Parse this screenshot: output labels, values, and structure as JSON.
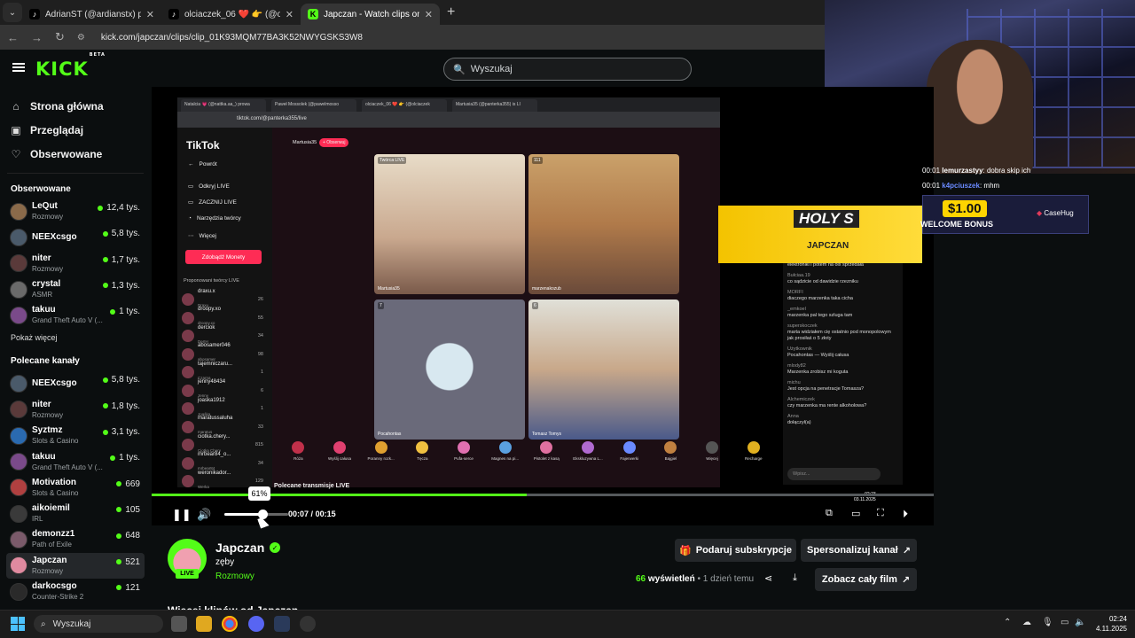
{
  "browser": {
    "tabs": [
      {
        "title": "AdrianST (@ardianstx) prowadzi",
        "active": false,
        "favicon": "tiktok-icon"
      },
      {
        "title": "olciaczek_06 ❤️ 👉 (@olciaczek",
        "active": false,
        "favicon": "tiktok-icon"
      },
      {
        "title": "Japczan - Watch clips on Kick",
        "active": true,
        "favicon": "kick-icon"
      }
    ],
    "url": "kick.com/japczan/clips/clip_01K93MQM77BA3K52NWYGSKS3W8"
  },
  "site": {
    "logo": "KICK",
    "logo_sup": "BETA",
    "search_placeholder": "Wyszukaj"
  },
  "sidebar": {
    "nav": [
      {
        "label": "Strona główna",
        "icon": "home-icon"
      },
      {
        "label": "Przeglądaj",
        "icon": "browse-icon"
      },
      {
        "label": "Obserwowane",
        "icon": "heart-icon"
      }
    ],
    "followed_title": "Obserwowane",
    "followed": [
      {
        "name": "LeQut",
        "category": "Rozmowy",
        "viewers": "12,4 tys.",
        "color": "#8a6a4a"
      },
      {
        "name": "NEEXcsgo",
        "category": "",
        "viewers": "5,8 tys.",
        "color": "#4a5a6a"
      },
      {
        "name": "niter",
        "category": "Rozmowy",
        "viewers": "1,7 tys.",
        "color": "#5a3a3a"
      },
      {
        "name": "crystal",
        "category": "ASMR",
        "viewers": "1,3 tys.",
        "color": "#6a6a6a"
      },
      {
        "name": "takuu",
        "category": "Grand Theft Auto V (...",
        "viewers": "1 tys.",
        "color": "#7a4a8a"
      }
    ],
    "show_more": "Pokaż więcej",
    "recommended_title": "Polecane kanały",
    "recommended": [
      {
        "name": "NEEXcsgo",
        "category": "",
        "viewers": "5,8 tys.",
        "color": "#4a5a6a"
      },
      {
        "name": "niter",
        "category": "Rozmowy",
        "viewers": "1,8 tys.",
        "color": "#5a3a3a"
      },
      {
        "name": "Syztmz",
        "category": "Slots & Casino",
        "viewers": "3,1 tys.",
        "color": "#2a6ab0"
      },
      {
        "name": "takuu",
        "category": "Grand Theft Auto V (...",
        "viewers": "1 tys.",
        "color": "#7a4a8a"
      },
      {
        "name": "Motivation",
        "category": "Slots & Casino",
        "viewers": "669",
        "color": "#b04040"
      },
      {
        "name": "aikoiemil",
        "category": "IRL",
        "viewers": "105",
        "color": "#3a3a3a"
      },
      {
        "name": "demonzz1",
        "category": "Path of Exile",
        "viewers": "648",
        "color": "#7a5a6a"
      },
      {
        "name": "Japczan",
        "category": "Rozmowy",
        "viewers": "521",
        "color": "#e08aa0",
        "selected": true
      },
      {
        "name": "darkocsgo",
        "category": "Counter-Strike 2",
        "viewers": "121",
        "color": "#2a2a2a"
      }
    ]
  },
  "video": {
    "inner_tabs": [
      "Natalcia 💗 (@nattka.aa_) prowa",
      "Paweł Mossolek (@pawelmosso",
      "olciaczek_06 ❤️ 👉 (@olciaczek",
      "Martusia35 (@panterka355) is LI"
    ],
    "inner_url": "tiktok.com/@panterka355/live",
    "tiktok": {
      "logo": "TikTok",
      "menu": [
        "Powrót",
        "Odkryj LIVE",
        "ZACZNIJ LIVE",
        "Narzędzia twórcy",
        "Więcej"
      ],
      "coins_button": "Zdobądź Monety",
      "suggested_title": "Proponowani twórcy LIVE",
      "creators": [
        {
          "name": "draxu.x",
          "sub": "Draxu",
          "count": "26"
        },
        {
          "name": "droopy.xo",
          "sub": "droopy.xo",
          "count": "55"
        },
        {
          "name": "derciok",
          "sub": "DerIH",
          "count": "34"
        },
        {
          "name": "abosamer046",
          "sub": "abosamer",
          "count": "98"
        },
        {
          "name": "tajemniczaru...",
          "sub": "Czarna",
          "count": "1"
        },
        {
          "name": "jenny48434",
          "sub": "Jenny",
          "count": "6"
        },
        {
          "name": "joaska1912",
          "sub": "Joaśka",
          "count": "1"
        },
        {
          "name": "maratussaluha",
          "sub": "maratus",
          "count": "33"
        },
        {
          "name": "ciotka.chery...",
          "sub": "Ciotka Chery",
          "count": "815"
        },
        {
          "name": "mrbear84_o...",
          "sub": "mrbear84",
          "count": "34"
        },
        {
          "name": "weronikador...",
          "sub": "Werka",
          "count": "129"
        }
      ],
      "host": "Martusia35",
      "follow_btn": "+ Obserwuj",
      "tiles": [
        {
          "label": "Martusia35",
          "tag": "Twórca LIVE"
        },
        {
          "label": "marzenakozub",
          "tag": "111"
        },
        {
          "label": "Pocahontas",
          "tag": "7"
        },
        {
          "label": "Tomasz Tomys",
          "tag": "6"
        }
      ],
      "gifts": [
        "Róża",
        "Wyślij całusa",
        "Poranny rozk...",
        "Tęcza",
        "Pufa-serce",
        "Magnes na pi...",
        "Pistolet z kasą",
        "Ekskluzywna L...",
        "Fajerwerki",
        "Bajgiel",
        "Więcej",
        "Recharge"
      ],
      "recommended_live": "Polecane transmisje LIVE",
      "chat": [
        {
          "user": "",
          "text": "ta klawiaturę dostała jak rozdawali w muzeum elektroniki i potem na olx sprzedała"
        },
        {
          "user": "Bułciaa.19",
          "text": "co sądzicie od dawidzie rzezniku"
        },
        {
          "user": "MORFI",
          "text": "diaczego marzenka taka cicha"
        },
        {
          "user": "_emkoel",
          "text": "marzenka pal tego szluga tam"
        },
        {
          "user": "superskoczek",
          "text": "marta widziałem cię ostatnio pod monopolowym jak prosiłaś o 5 złoty"
        },
        {
          "user": "Użytkownik",
          "text": "Pocahontas — Wyślij całusa"
        },
        {
          "user": "mlody82",
          "text": "Marzenka zrobisz mi koguta"
        },
        {
          "user": "michu",
          "text": "Jest opcja na penetracje Tomasza?"
        },
        {
          "user": "Alchemiczek",
          "text": "czy marzenka ma rente alkoholowa?"
        },
        {
          "user": "Anna",
          "text": "dołączył(a)"
        }
      ],
      "chat_placeholder": "Wpisz..."
    },
    "overlay": {
      "chat_lines": [
        {
          "time": "00:01",
          "user": "lemurzastyy",
          "text": "dobra skip ich"
        },
        {
          "time": "00:01",
          "user": "k4pciuszek",
          "text": "mhm"
        }
      ],
      "ad_text": "HOLY S",
      "ad_sub": "JAPCZAN",
      "bonus": "$1.00",
      "bonus_label": "WELCOME BONUS",
      "brand": "CaseHug"
    },
    "inner_clock": {
      "time": "02:23",
      "date": "03.11.2025"
    },
    "volume_pct": 61,
    "volume_label": "61%",
    "progress_fraction": 0.48,
    "time_current": "00:07",
    "time_sep": "/",
    "time_total": "00:15"
  },
  "clip": {
    "channel": "Japczan",
    "live_badge": "LIVE",
    "title": "zęby",
    "category": "Rozmowy",
    "views": "66",
    "views_label": "wyświetleń",
    "age": "• 1 dzień temu",
    "gift_sub_button": "Podaruj subskrypcje",
    "personalize_button": "Spersonalizuj kanał",
    "full_video_button": "Zobacz cały film",
    "more_clips": "Więcej klipów od Japczan"
  },
  "taskbar": {
    "search": "Wyszukaj",
    "time": "02:24",
    "date": "4.11.2025"
  }
}
